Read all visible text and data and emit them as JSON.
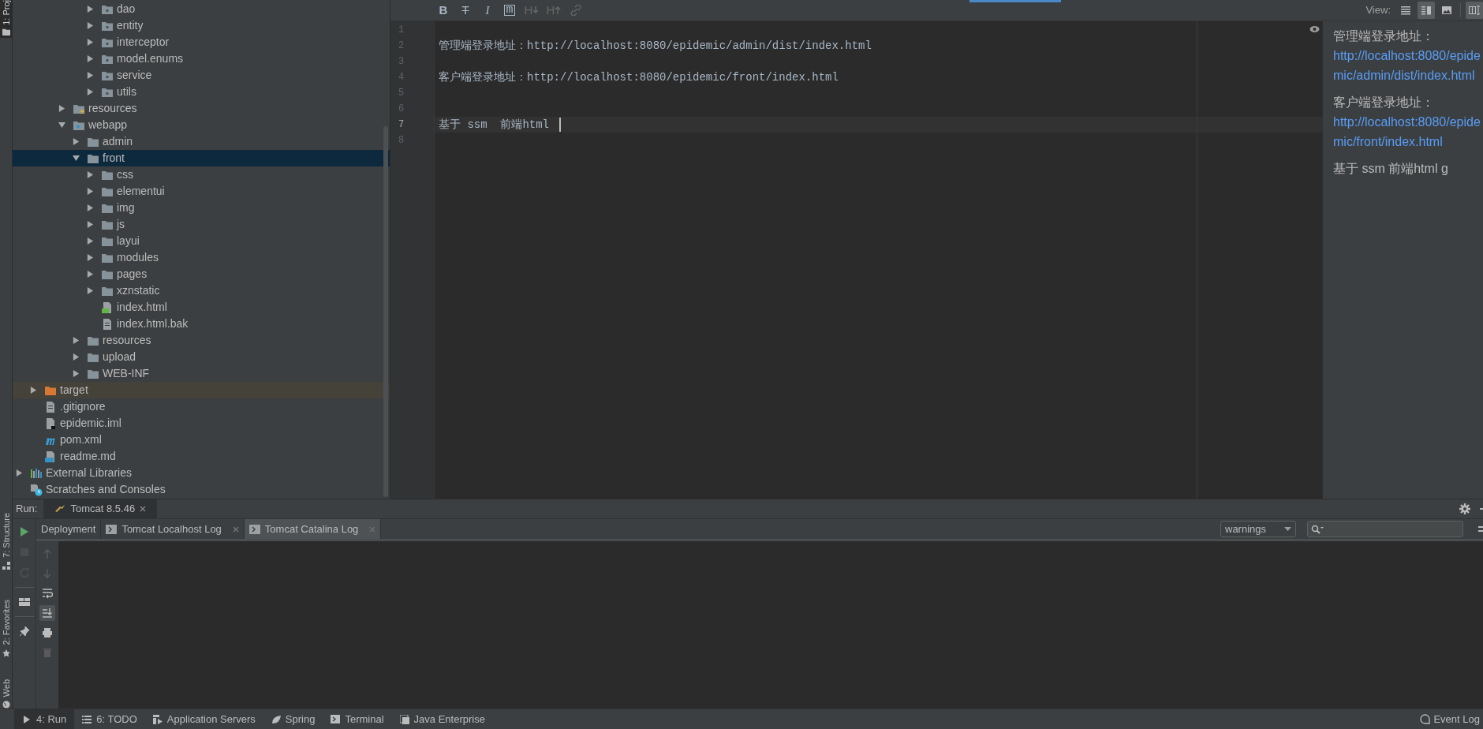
{
  "side_strip": {
    "top_tabs": [
      {
        "label": "1: Proj",
        "selected": true
      }
    ],
    "bottom_tabs": [
      {
        "label": "7: Structure",
        "kind": "structure"
      },
      {
        "label": "2: Favorites",
        "kind": "favorites"
      },
      {
        "label": "Web",
        "kind": "web"
      }
    ]
  },
  "project_tree": [
    {
      "children": [
        {
          "children": [
            {
              "children": [
                {
                  "children": [
                    {
                      "children": [
                        {
                          "label": "dao",
                          "kind": "package",
                          "expanded": false,
                          "selected": false
                        },
                        {
                          "label": "entity",
                          "kind": "package",
                          "expanded": false,
                          "selected": false
                        },
                        {
                          "label": "interceptor",
                          "kind": "package",
                          "expanded": false,
                          "selected": false
                        },
                        {
                          "label": "model.enums",
                          "kind": "package",
                          "expanded": false,
                          "selected": false
                        },
                        {
                          "label": "service",
                          "kind": "package",
                          "expanded": false,
                          "selected": false
                        },
                        {
                          "label": "utils",
                          "kind": "package",
                          "expanded": false,
                          "selected": false
                        }
                      ]
                    }
                  ]
                },
                {
                  "label": "resources",
                  "kind": "resources",
                  "expanded": false,
                  "selected": false
                },
                {
                  "label": "webapp",
                  "kind": "webapp",
                  "expanded": true,
                  "selected": false,
                  "children": [
                    {
                      "label": "admin",
                      "kind": "folder",
                      "expanded": false,
                      "selected": false
                    },
                    {
                      "label": "front",
                      "kind": "folder",
                      "expanded": true,
                      "selected": true,
                      "children": [
                        {
                          "label": "css",
                          "kind": "folder",
                          "expanded": false,
                          "selected": false
                        },
                        {
                          "label": "elementui",
                          "kind": "folder",
                          "expanded": false,
                          "selected": false
                        },
                        {
                          "label": "img",
                          "kind": "folder",
                          "expanded": false,
                          "selected": false
                        },
                        {
                          "label": "js",
                          "kind": "folder",
                          "expanded": false,
                          "selected": false
                        },
                        {
                          "label": "layui",
                          "kind": "folder",
                          "expanded": false,
                          "selected": false
                        },
                        {
                          "label": "modules",
                          "kind": "folder",
                          "expanded": false,
                          "selected": false
                        },
                        {
                          "label": "pages",
                          "kind": "folder",
                          "expanded": false,
                          "selected": false
                        },
                        {
                          "label": "xznstatic",
                          "kind": "folder",
                          "expanded": false,
                          "selected": false
                        },
                        {
                          "label": "index.html",
                          "kind": "html",
                          "selected": false
                        },
                        {
                          "label": "index.html.bak",
                          "kind": "file",
                          "selected": false
                        }
                      ]
                    },
                    {
                      "label": "resources",
                      "kind": "folder",
                      "expanded": false,
                      "selected": false
                    },
                    {
                      "label": "upload",
                      "kind": "folder",
                      "expanded": false,
                      "selected": false
                    },
                    {
                      "label": "WEB-INF",
                      "kind": "folder",
                      "expanded": false,
                      "selected": false
                    }
                  ]
                }
              ]
            }
          ]
        },
        {
          "label": "target",
          "kind": "excluded",
          "expanded": false,
          "selected": false
        },
        {
          "label": ".gitignore",
          "kind": "file",
          "selected": false
        },
        {
          "label": "epidemic.iml",
          "kind": "iml",
          "selected": false
        },
        {
          "label": "pom.xml",
          "kind": "maven",
          "selected": false
        },
        {
          "label": "readme.md",
          "kind": "markdown",
          "selected": false
        }
      ]
    },
    {
      "label": "External Libraries",
      "kind": "libraries",
      "expanded": false,
      "selected": false
    },
    {
      "label": "Scratches and Consoles",
      "kind": "scratches",
      "selected": false
    }
  ],
  "editor": {
    "format_buttons": [
      {
        "glyph": "B",
        "kind": "bold",
        "disabled": false
      },
      {
        "glyph": "T",
        "kind": "strike",
        "disabled": false
      },
      {
        "glyph": "I",
        "kind": "italic",
        "disabled": false
      },
      {
        "glyph": "m",
        "kind": "code",
        "disabled": false
      },
      {
        "glyph": "H",
        "kind": "header-down",
        "disabled": true
      },
      {
        "glyph": "H",
        "kind": "header-up",
        "disabled": true
      },
      {
        "kind": "link",
        "disabled": true
      }
    ],
    "view_label": "View:",
    "view_modes": [
      {
        "kind": "editor",
        "selected": false
      },
      {
        "kind": "split",
        "selected": true
      },
      {
        "kind": "preview",
        "selected": false
      }
    ],
    "lines": [
      {
        "number": "1",
        "current": false
      },
      {
        "number": "2",
        "text": "管理端登录地址：http://localhost:8080/epidemic/admin/dist/index.html",
        "current": false
      },
      {
        "number": "3",
        "current": false
      },
      {
        "number": "4",
        "text": "客户端登录地址：http://localhost:8080/epidemic/front/index.html",
        "current": false
      },
      {
        "number": "5",
        "current": false
      },
      {
        "number": "6",
        "current": false
      },
      {
        "number": "7",
        "text": "基于 ssm  前端html",
        "current": true
      },
      {
        "number": "8",
        "current": false
      }
    ],
    "preview": [
      {
        "text": "管理端登录地址：",
        "link": "http://localhost:8080/epidemic/admin/dist/index.html"
      },
      {
        "text": "客户端登录地址：",
        "link": "http://localhost:8080/epidemic/front/index.html"
      },
      {
        "text": "基于 ssm 前端html g"
      }
    ]
  },
  "run_panel": {
    "label": "Run:",
    "config_tab": "Tomcat 8.5.46",
    "actions": [
      {
        "kind": "run",
        "disabled": false
      },
      {
        "kind": "stop",
        "disabled": true
      },
      {
        "kind": "rerun",
        "disabled": true
      },
      {
        "kind": "layout",
        "disabled": false
      },
      {
        "kind": "pin",
        "disabled": false
      }
    ],
    "tabs": [
      {
        "label": "Deployment",
        "kind": "plain",
        "selected": false
      },
      {
        "label": "Tomcat Localhost Log",
        "kind": "log",
        "selected": false
      },
      {
        "label": "Tomcat Catalina Log",
        "kind": "log",
        "selected": true
      }
    ],
    "filter": "warnings",
    "console_actions": [
      {
        "kind": "up",
        "disabled": true,
        "selected": false
      },
      {
        "kind": "down",
        "disabled": true,
        "selected": false
      },
      {
        "kind": "wrap",
        "disabled": false,
        "selected": false
      },
      {
        "kind": "scroll-end",
        "disabled": false,
        "selected": true
      },
      {
        "kind": "print",
        "disabled": false,
        "selected": false
      },
      {
        "kind": "trash",
        "disabled": true,
        "selected": false
      }
    ]
  },
  "status_bar": {
    "tools": [
      {
        "label": "4: Run",
        "kind": "run",
        "selected": true
      },
      {
        "label": "6: TODO",
        "kind": "todo",
        "selected": false
      },
      {
        "label": "Application Servers",
        "kind": "servers",
        "selected": false
      },
      {
        "label": "Spring",
        "kind": "spring",
        "selected": false
      },
      {
        "label": "Terminal",
        "kind": "terminal",
        "selected": false
      },
      {
        "label": "Java Enterprise",
        "kind": "javaee",
        "selected": false
      }
    ],
    "event_log": "Event Log"
  }
}
